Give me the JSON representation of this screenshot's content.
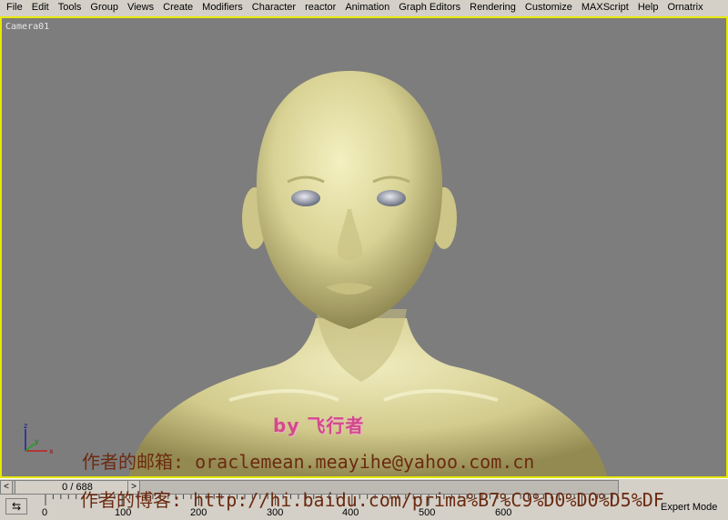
{
  "menu": {
    "items": [
      "File",
      "Edit",
      "Tools",
      "Group",
      "Views",
      "Create",
      "Modifiers",
      "Character",
      "reactor",
      "Animation",
      "Graph Editors",
      "Rendering",
      "Customize",
      "MAXScript",
      "Help",
      "Ornatrix"
    ]
  },
  "viewport": {
    "label": "Camera01",
    "border_color": "#e8e800",
    "background_color": "#7d7d7d"
  },
  "axis_gizmo": {
    "x": "x",
    "y": "y",
    "z": "z"
  },
  "watermark": {
    "by_text": "by 飞行者",
    "email_line": "作者的邮箱: oraclemean.meayihe@yahoo.com.cn",
    "blog_line": "作者的博客: http://hi.baidu.com/prima%B7%C9%D0%D0%D5%DF"
  },
  "timeslider": {
    "frame_display": "0 / 688",
    "prev_label": "<",
    "next_label": ">"
  },
  "trackbar": {
    "ticks": [
      "0",
      "100",
      "200",
      "300",
      "400",
      "500",
      "600"
    ],
    "mode_label": "Expert Mode"
  }
}
